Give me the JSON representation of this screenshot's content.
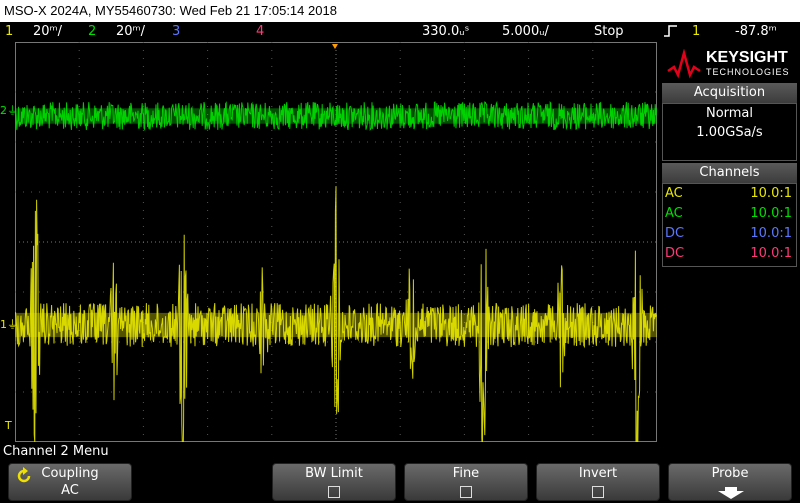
{
  "title": "MSO-X 2024A, MY55460730: Wed Feb 21 17:05:14 2018",
  "status": {
    "ch1": {
      "num": "1",
      "scale": "20ᵐ/",
      "color": "#e8e800"
    },
    "ch2": {
      "num": "2",
      "scale": "20ᵐ/",
      "color": "#00e000"
    },
    "ch3": {
      "num": "3",
      "color": "#5a78ff"
    },
    "ch4": {
      "num": "4",
      "color": "#ff3a78"
    },
    "time_delay": "330.0ᵤˢ",
    "time_scale": "5.000ᵤ/",
    "run_state": "Stop",
    "trigger_source": "1",
    "trigger_level": "-87.8ᵐ"
  },
  "logo": {
    "brand": "KEYSIGHT",
    "sub": "TECHNOLOGIES"
  },
  "acquisition": {
    "title": "Acquisition",
    "mode": "Normal",
    "rate": "1.00GSa/s"
  },
  "channels": {
    "title": "Channels",
    "rows": [
      {
        "coupling": "AC",
        "probe": "10.0:1",
        "color": "#e8e800"
      },
      {
        "coupling": "AC",
        "probe": "10.0:1",
        "color": "#00e000"
      },
      {
        "coupling": "DC",
        "probe": "10.0:1",
        "color": "#5a78ff"
      },
      {
        "coupling": "DC",
        "probe": "10.0:1",
        "color": "#ff3a78"
      }
    ]
  },
  "markers": {
    "ch2": "2",
    "ch1": "1",
    "trig": "T"
  },
  "menu": {
    "label": "Channel 2 Menu"
  },
  "softkeys": {
    "coupling": {
      "title": "Coupling",
      "value": "AC"
    },
    "bw_limit": {
      "title": "BW Limit"
    },
    "fine": {
      "title": "Fine"
    },
    "invert": {
      "title": "Invert"
    },
    "probe": {
      "title": "Probe"
    }
  },
  "icons": {
    "coupling": "rotate-knob-icon",
    "probe": "down-arrow-icon",
    "trigger": "rising-edge-icon",
    "logo": "keysight-wave-icon"
  }
}
